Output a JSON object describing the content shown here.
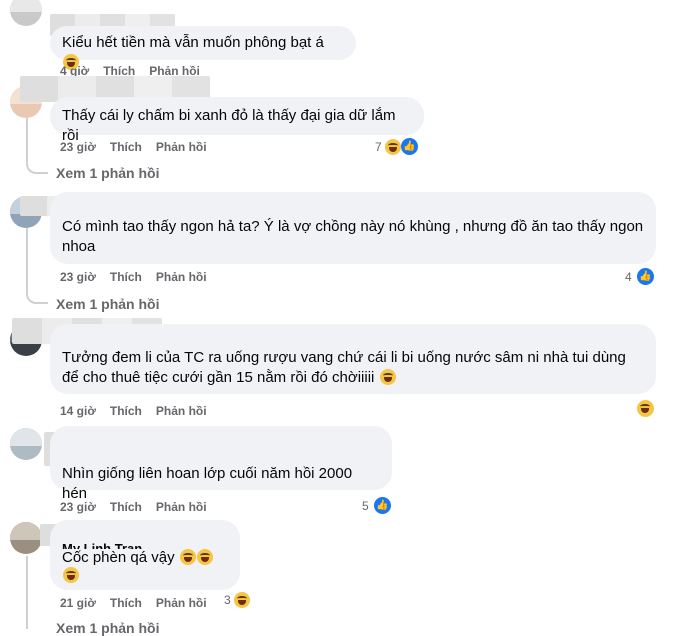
{
  "comments": [
    {
      "text": "Kiểu hết tiền mà vẫn muốn phông bạt á",
      "time": "4 giờ",
      "like": "Thích",
      "reply": "Phản hồi",
      "reactions": ""
    },
    {
      "text": "Thấy cái ly chấm bi xanh đỏ là thấy đại gia dữ lắm rồi",
      "time": "23 giờ",
      "like": "Thích",
      "reply": "Phản hồi",
      "reactions": "7",
      "view_replies": "Xem 1 phản hồi"
    },
    {
      "text": "Có mình tao thấy ngon hả ta? Ý là vợ chồng này nó khùng , nhưng đồ ăn tao thấy ngon nhoa",
      "time": "23 giờ",
      "like": "Thích",
      "reply": "Phản hồi",
      "reactions": "4",
      "view_replies": "Xem 1 phản hồi"
    },
    {
      "text": "Tưởng đem li của TC ra uống rượu vang chứ cái li bi uống nước sâm ni nhà tui dùng để cho thuê tiệc cưới gần 15 nằm rồi đó chờiiiii",
      "time": "14 giờ",
      "like": "Thích",
      "reply": "Phản hồi",
      "reactions": ""
    },
    {
      "text": "Nhìn giống liên hoan lớp cuối năm hồi 2000 hén",
      "time": "23 giờ",
      "like": "Thích",
      "reply": "Phản hồi",
      "reactions": "5"
    },
    {
      "partial_name": "My Linh Tran",
      "text": "Cốc phèn qá vậy",
      "time": "21 giờ",
      "like": "Thích",
      "reply": "Phản hồi",
      "reactions": "3",
      "view_replies": "Xem 1 phản hồi"
    }
  ]
}
